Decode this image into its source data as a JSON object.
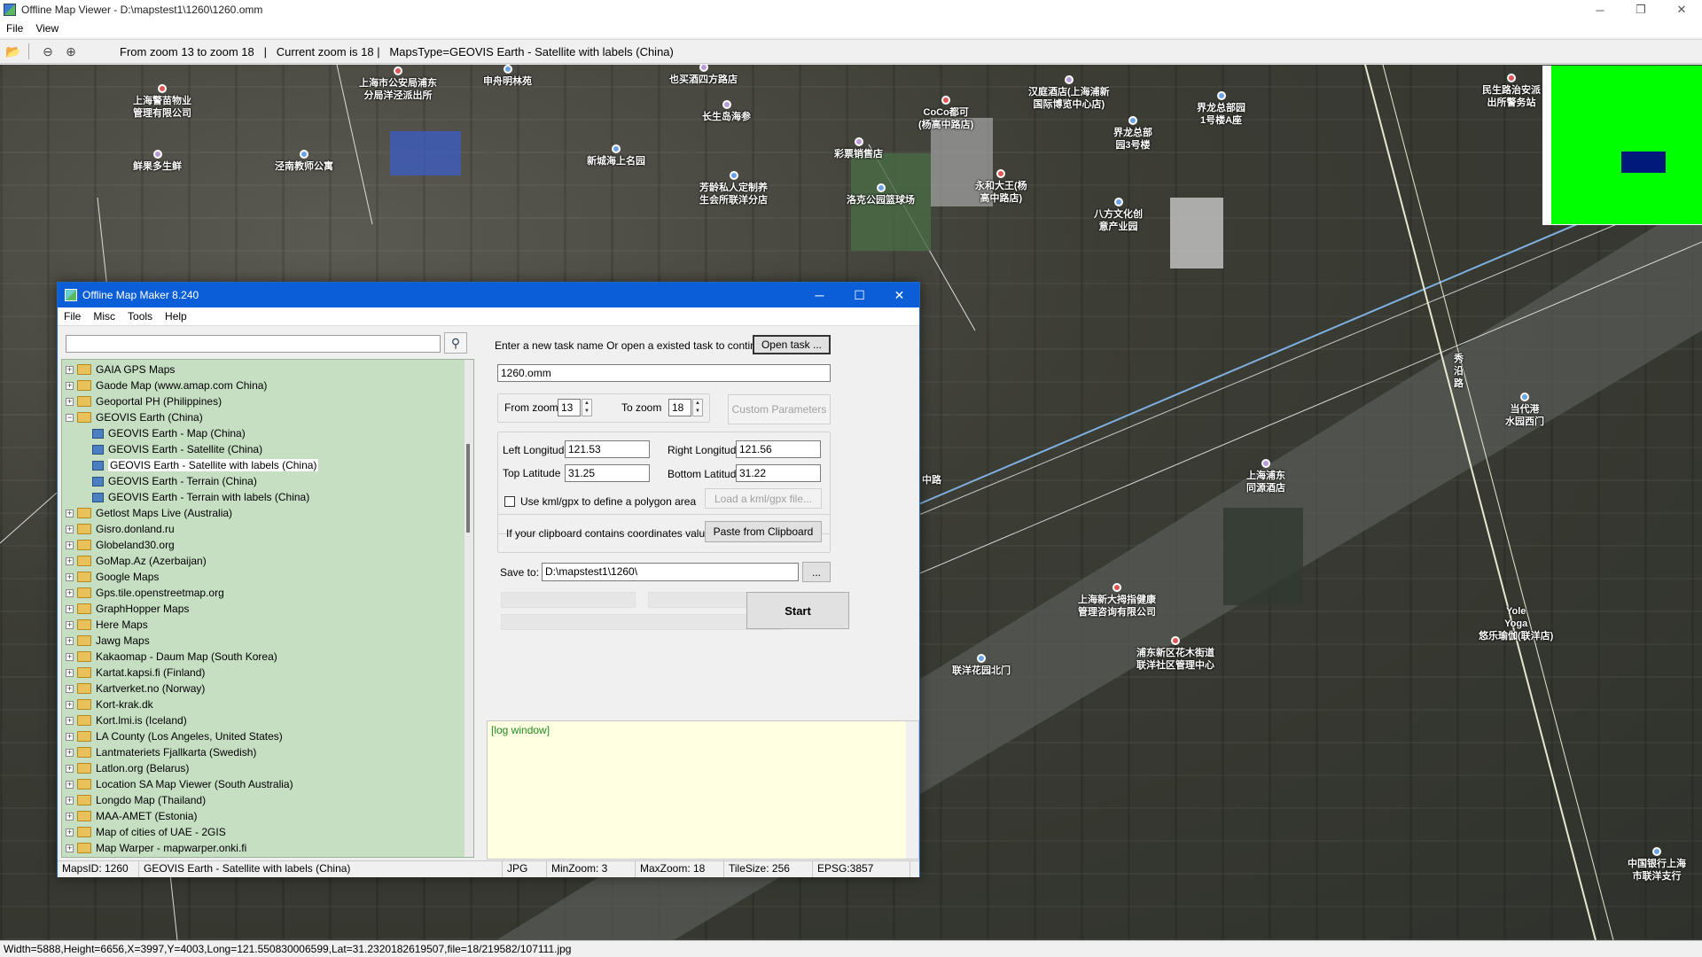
{
  "window": {
    "title": "Offline Map Viewer - D:\\mapstest1\\1260\\1260.omm",
    "min": "─",
    "max": "❐",
    "close": "✕"
  },
  "menu": [
    "File",
    "View"
  ],
  "toolbar": {
    "info": "From zoom 13 to zoom 18   |   Current zoom is 18 |   MapsType=GEOVIS Earth - Satellite with labels (China)"
  },
  "map": {
    "pois": [
      "上海市公安局浦东\n分局洋泾派出所",
      "申舟明林苑",
      "也买酒四方路店",
      "长生岛海参",
      "上海警苗物业\n管理有限公司",
      "鲜果多生鲜",
      "泾南教师公寓",
      "新城海上名园",
      "芳龄私人定制养\n生会所联洋分店",
      "彩票销售店",
      "CoCo都可\n(杨高中路店)",
      "洛克公园篮球场",
      "汉庭酒店(上海浦新\n国际博览中心店)",
      "永和大王(杨\n高中路店)",
      "界龙总部园\n1号楼A座",
      "界龙总部\n园3号楼",
      "八方文化创\n意产业园",
      "民生路治安派\n出所警务站",
      "当代港\n水园西门",
      "上海浦东\n同源酒店",
      "上海新大拇指健康\n管理咨询有限公司",
      "浦东新区花木街道\n联洋社区管理中心",
      "联洋花园北门",
      "Yole\nYoga\n悠乐瑜伽(联洋店)",
      "中国银行上海\n市联洋支行",
      "秀\n沿\n路",
      "中路"
    ]
  },
  "statusbar": "Width=5888,Height=6656,X=3997,Y=4003,Long=121.550830006599,Lat=31.2320182619507,file=18/219582/107111.jpg",
  "dialog": {
    "title": "Offline Map Maker 8.240",
    "menu": [
      "File",
      "Misc",
      "Tools",
      "Help"
    ],
    "search_placeholder": "",
    "tree": [
      {
        "label": "GAIA GPS Maps",
        "type": "folder",
        "exp": "+"
      },
      {
        "label": "Gaode Map (www.amap.com China)",
        "type": "folder",
        "exp": "+"
      },
      {
        "label": "Geoportal PH (Philippines)",
        "type": "folder",
        "exp": "+"
      },
      {
        "label": "GEOVIS Earth (China)",
        "type": "folder",
        "exp": "−"
      },
      {
        "label": "GEOVIS Earth - Map (China)",
        "type": "map"
      },
      {
        "label": "GEOVIS Earth - Satellite (China)",
        "type": "map"
      },
      {
        "label": "GEOVIS Earth - Satellite with labels (China)",
        "type": "map",
        "selected": true
      },
      {
        "label": "GEOVIS Earth - Terrain (China)",
        "type": "map"
      },
      {
        "label": "GEOVIS Earth - Terrain with labels (China)",
        "type": "map"
      },
      {
        "label": "Getlost Maps Live (Australia)",
        "type": "folder",
        "exp": "+"
      },
      {
        "label": "Gisro.donland.ru",
        "type": "folder",
        "exp": "+"
      },
      {
        "label": "Globeland30.org",
        "type": "folder",
        "exp": "+"
      },
      {
        "label": "GoMap.Az (Azerbaijan)",
        "type": "folder",
        "exp": "+"
      },
      {
        "label": "Google Maps",
        "type": "folder",
        "exp": "+"
      },
      {
        "label": "Gps.tile.openstreetmap.org",
        "type": "folder",
        "exp": "+"
      },
      {
        "label": "GraphHopper Maps",
        "type": "folder",
        "exp": "+"
      },
      {
        "label": "Here Maps",
        "type": "folder",
        "exp": "+"
      },
      {
        "label": "Jawg Maps",
        "type": "folder",
        "exp": "+"
      },
      {
        "label": "Kakaomap - Daum Map (South Korea)",
        "type": "folder",
        "exp": "+"
      },
      {
        "label": "Kartat.kapsi.fi (Finland)",
        "type": "folder",
        "exp": "+"
      },
      {
        "label": "Kartverket.no (Norway)",
        "type": "folder",
        "exp": "+"
      },
      {
        "label": "Kort-krak.dk",
        "type": "folder",
        "exp": "+"
      },
      {
        "label": "Kort.lmi.is (Iceland)",
        "type": "folder",
        "exp": "+"
      },
      {
        "label": "LA County (Los Angeles, United States)",
        "type": "folder",
        "exp": "+"
      },
      {
        "label": "Lantmateriets Fjallkarta (Swedish)",
        "type": "folder",
        "exp": "+"
      },
      {
        "label": "Latlon.org (Belarus)",
        "type": "folder",
        "exp": "+"
      },
      {
        "label": "Location SA Map Viewer (South Australia)",
        "type": "folder",
        "exp": "+"
      },
      {
        "label": "Longdo Map (Thailand)",
        "type": "folder",
        "exp": "+"
      },
      {
        "label": "MAA-AMET (Estonia)",
        "type": "folder",
        "exp": "+"
      },
      {
        "label": "Map of cities of UAE - 2GIS",
        "type": "folder",
        "exp": "+"
      },
      {
        "label": "Map Warper - mapwarper.onki.fi",
        "type": "folder",
        "exp": "+"
      }
    ],
    "task_prompt": "Enter a new task name Or open a existed task to continue:",
    "open_task": "Open task ...",
    "task_name": "1260.omm",
    "from_zoom_label": "From zoom",
    "from_zoom": "13",
    "to_zoom_label": "To zoom",
    "to_zoom": "18",
    "custom_params": "Custom Parameters",
    "left_lon_label": "Left Longitude",
    "left_lon": "121.53",
    "right_lon_label": "Right Longitude",
    "right_lon": "121.56",
    "top_lat_label": "Top Latitude",
    "top_lat": "31.25",
    "bottom_lat_label": "Bottom Latitude",
    "bottom_lat": "31.22",
    "kml_label": "Use kml/gpx to define a polygon area",
    "load_kml": "Load a kml/gpx file...",
    "clipboard_label": "If your clipboard contains coordinates values:",
    "paste": "Paste from Clipboard",
    "save_to_label": "Save to:",
    "save_to": "D:\\mapstest1\\1260\\",
    "browse": "...",
    "start": "Start",
    "log": "[log window]",
    "status": {
      "maps_id": "MapsID: 1260",
      "name": "GEOVIS Earth - Satellite with labels (China)",
      "format": "JPG",
      "min_zoom": "MinZoom: 3",
      "max_zoom": "MaxZoom: 18",
      "tile_size": "TileSize: 256",
      "epsg": "EPSG:3857"
    }
  }
}
